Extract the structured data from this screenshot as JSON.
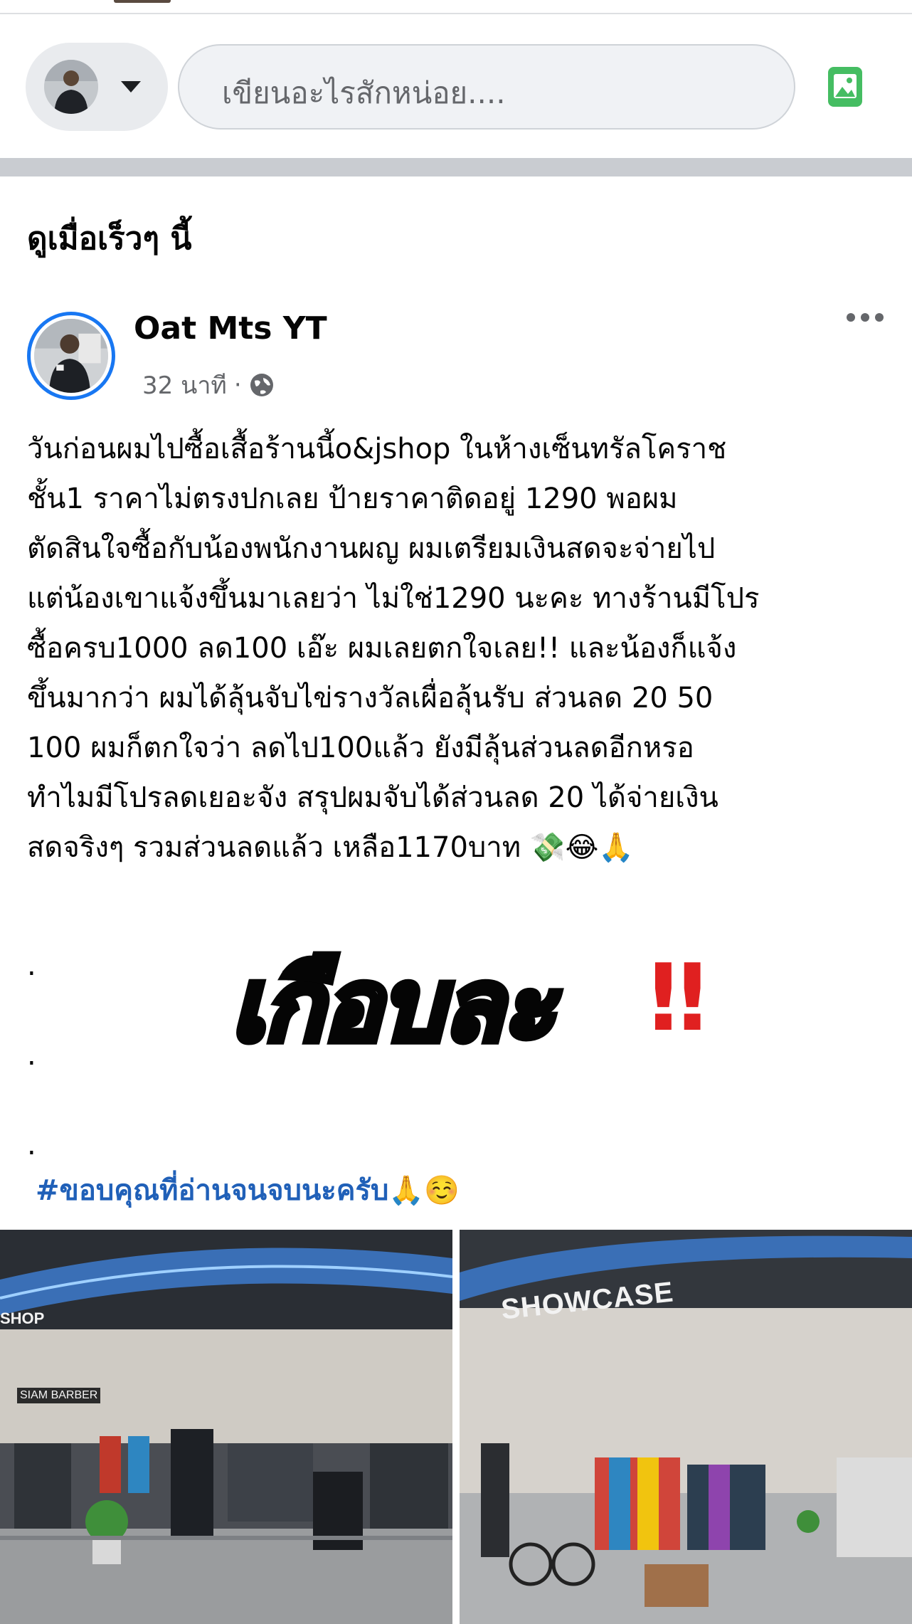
{
  "composer": {
    "placeholder": "เขียนอะไรสักหน่อย...."
  },
  "section": {
    "title": "ดูเมื่อเร็วๆ นี้"
  },
  "post": {
    "author": "Oat Mts YT",
    "time": "32 นาที",
    "separator": "·",
    "privacy_icon": "globe-icon",
    "lines": [
      "วันก่อนผมไปซื้อเสื้อร้านนี้o&jshop ในห้างเซ็นทรัลโคราช",
      "ชั้น1  ราคาไม่ตรงปกเลย ป้ายราคาติดอยู่ 1290 พอผม",
      "ตัดสินใจซื้อกับน้องพนักงานผญ ผมเตรียมเงินสดจะจ่ายไป",
      "แต่น้องเขาแจ้งขึ้นมาเลยว่า ไม่ใช่1290 นะคะ ทางร้านมีโปร",
      "ซื้อครบ1000 ลด100 เอ๊ะ ผมเลยตกใจเลย!! และน้องก็แจ้ง",
      "ขึ้นมากว่า ผมได้ลุ้นจับไข่รางวัลเผื่อลุ้นรับ ส่วนลด 20 50",
      "100  ผมก็ตกใจว่า ลดไป100แล้ว ยังมีลุ้นส่วนลดอีกหรอ",
      "ทำไมมีโปรลดเยอะจัง สรุปผมจับได้ส่วนลด 20 ได้จ่ายเงิน",
      "สดจริงๆ รวมส่วนลดแล้ว เหลือ1170บาท "
    ],
    "line_emojis": "💸😂🙏",
    "dots": [
      ".",
      ".",
      "."
    ],
    "big_text": "เกือบละ",
    "big_marks": "‼",
    "hashtag": "#ขอบคุณที่อ่านจนจบนะครับ🙏☺️",
    "photos": [
      {
        "sign": "SHOP",
        "sub_sign": "SIAM BARBER"
      },
      {
        "sign": "SHOWCASE"
      }
    ]
  },
  "colors": {
    "accent": "#1877f2",
    "hashtag": "#2060b8",
    "alert": "#e02020",
    "divider": "#c9ccd1"
  }
}
